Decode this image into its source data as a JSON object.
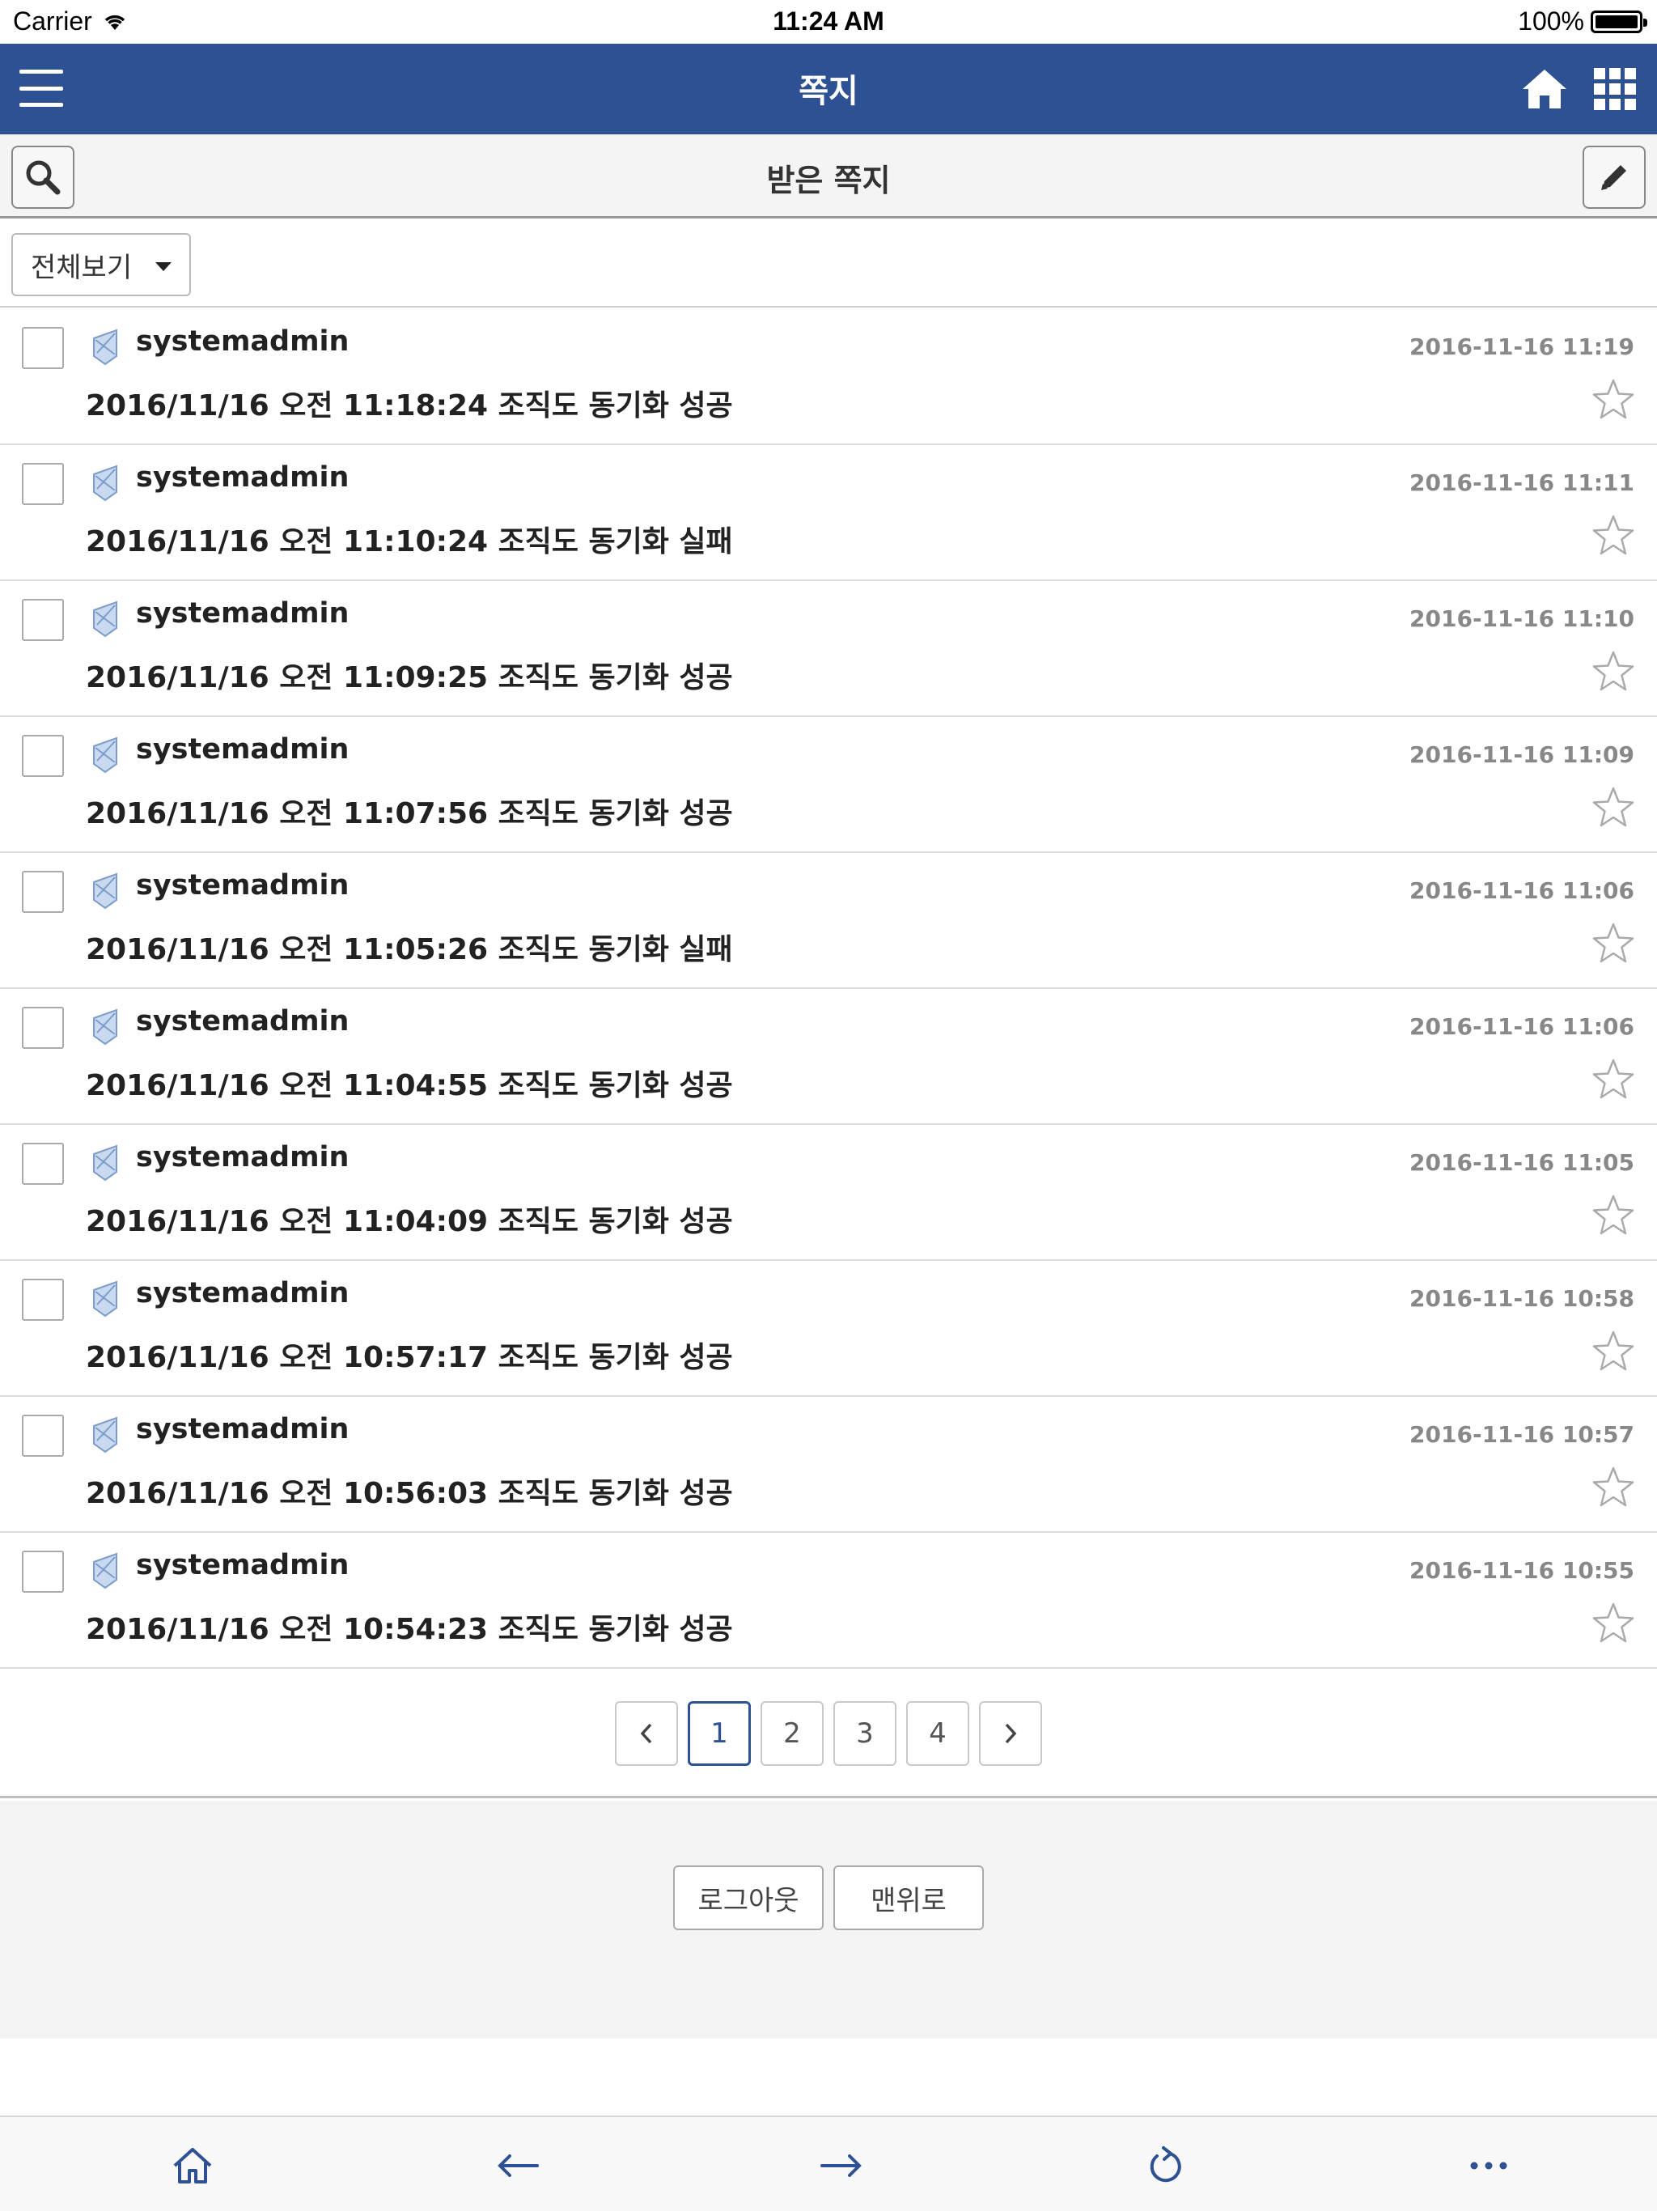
{
  "status_bar": {
    "carrier": "Carrier",
    "time": "11:24 AM",
    "battery": "100%"
  },
  "header": {
    "title": "쪽지"
  },
  "subheader": {
    "title": "받은 쪽지"
  },
  "filter": {
    "selected": "전체보기"
  },
  "messages": [
    {
      "sender": "systemadmin",
      "date": "2016-11-16 11:19",
      "subject": "2016/11/16 오전 11:18:24 조직도 동기화 성공"
    },
    {
      "sender": "systemadmin",
      "date": "2016-11-16 11:11",
      "subject": "2016/11/16 오전 11:10:24 조직도 동기화 실패"
    },
    {
      "sender": "systemadmin",
      "date": "2016-11-16 11:10",
      "subject": "2016/11/16 오전 11:09:25 조직도 동기화 성공"
    },
    {
      "sender": "systemadmin",
      "date": "2016-11-16 11:09",
      "subject": "2016/11/16 오전 11:07:56 조직도 동기화 성공"
    },
    {
      "sender": "systemadmin",
      "date": "2016-11-16 11:06",
      "subject": "2016/11/16 오전 11:05:26 조직도 동기화 실패"
    },
    {
      "sender": "systemadmin",
      "date": "2016-11-16 11:06",
      "subject": "2016/11/16 오전 11:04:55 조직도 동기화 성공"
    },
    {
      "sender": "systemadmin",
      "date": "2016-11-16 11:05",
      "subject": "2016/11/16 오전 11:04:09 조직도 동기화 성공"
    },
    {
      "sender": "systemadmin",
      "date": "2016-11-16 10:58",
      "subject": "2016/11/16 오전 10:57:17 조직도 동기화 성공"
    },
    {
      "sender": "systemadmin",
      "date": "2016-11-16 10:57",
      "subject": "2016/11/16 오전 10:56:03 조직도 동기화 성공"
    },
    {
      "sender": "systemadmin",
      "date": "2016-11-16 10:55",
      "subject": "2016/11/16 오전 10:54:23 조직도 동기화 성공"
    }
  ],
  "pagination": {
    "prev": "‹",
    "next": "›",
    "pages": [
      "1",
      "2",
      "3",
      "4"
    ],
    "current": "1"
  },
  "footer": {
    "logout_label": "로그아웃",
    "top_label": "맨위로"
  },
  "colors": {
    "brand": "#2e5193",
    "toolbar_icon": "#2e5193"
  },
  "icons": {
    "menu": "hamburger-icon",
    "home": "home-icon",
    "apps": "grid-icon",
    "search": "search-icon",
    "compose": "pencil-icon",
    "message": "mail-icon",
    "favorite": "star-icon"
  }
}
